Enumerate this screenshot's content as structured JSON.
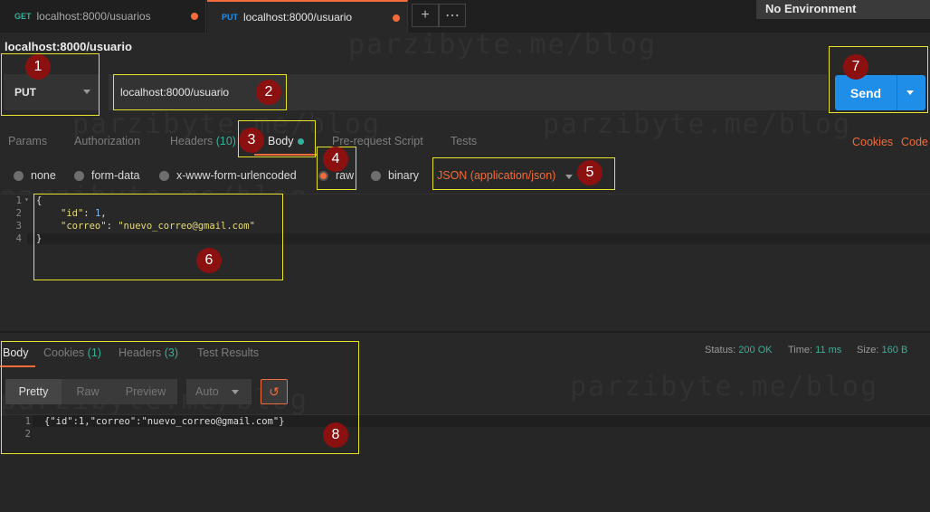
{
  "tabs": [
    {
      "method": "GET",
      "url": "localhost:8000/usuarios",
      "method_color": "#35b199"
    },
    {
      "method": "PUT",
      "url": "localhost:8000/usuario",
      "method_color": "#1f8ee8"
    }
  ],
  "environment": "No Environment",
  "request": {
    "title": "localhost:8000/usuario",
    "method": "PUT",
    "url": "localhost:8000/usuario",
    "send_label": "Send"
  },
  "request_tabs": {
    "params": "Params",
    "authorization": "Authorization",
    "headers": "Headers",
    "headers_count": "(10)",
    "body": "Body",
    "pre_request": "Pre-request Script",
    "tests": "Tests",
    "cookies": "Cookies",
    "code": "Code"
  },
  "body_types": {
    "none": "none",
    "form_data": "form-data",
    "urlencoded": "x-www-form-urlencoded",
    "raw": "raw",
    "binary": "binary",
    "content_type": "JSON (application/json)"
  },
  "request_body": {
    "line_numbers": [
      "1",
      "2",
      "3",
      "4"
    ],
    "open": "{",
    "id_key": "\"id\"",
    "id_value": "1",
    "correo_key": "\"correo\"",
    "correo_value": "\"nuevo_correo@gmail.com\"",
    "close": "}"
  },
  "response": {
    "tabs": {
      "body": "Body",
      "cookies": "Cookies",
      "cookies_count": "(1)",
      "headers": "Headers",
      "headers_count": "(3)",
      "test_results": "Test Results"
    },
    "status_label": "Status:",
    "status_value": "200 OK",
    "time_label": "Time:",
    "time_value": "11 ms",
    "size_label": "Size:",
    "size_value": "160 B",
    "view_modes": {
      "pretty": "Pretty",
      "raw": "Raw",
      "preview": "Preview",
      "format": "Auto"
    },
    "line_numbers": [
      "1",
      "2"
    ],
    "body_text": "{\"id\":1,\"correo\":\"nuevo_correo@gmail.com\"}"
  },
  "annotations": [
    "1",
    "2",
    "3",
    "4",
    "5",
    "6",
    "7",
    "8"
  ],
  "watermark": "parzibyte.me/blog",
  "colors": {
    "accent": "#f26b3a",
    "send": "#1f8ee8",
    "ok": "#35b199",
    "annotation_box": "#e8e22a",
    "marker": "#8b1010"
  }
}
